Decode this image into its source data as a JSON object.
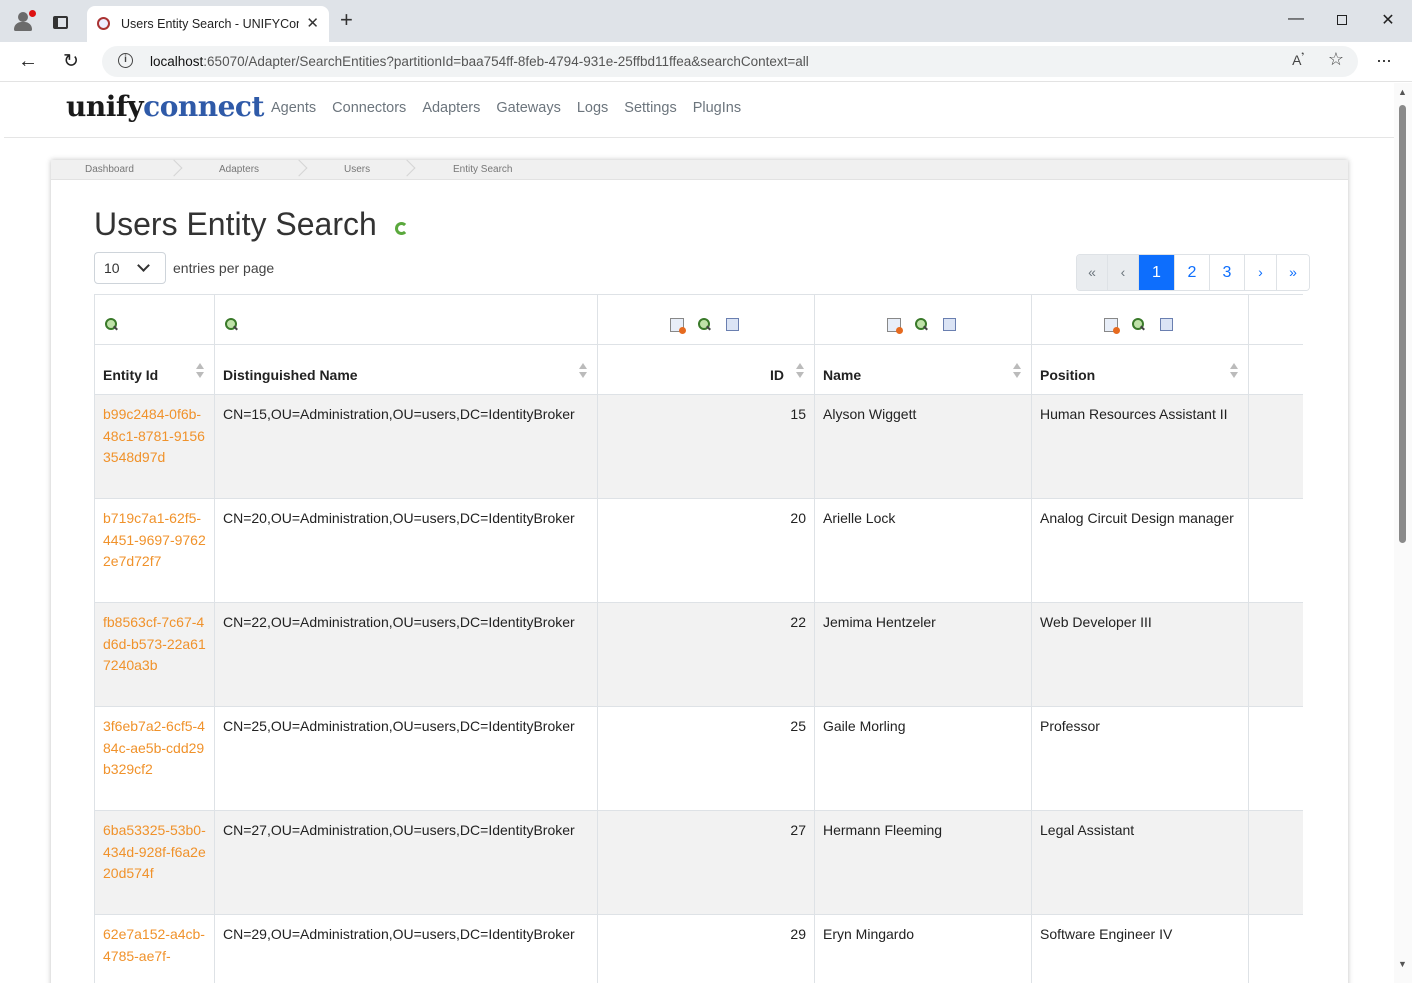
{
  "browser": {
    "tab_title": "Users Entity Search - UNIFYConnect",
    "tab_close": "✕",
    "new_tab": "+",
    "url_host": "localhost",
    "url_rest": ":65070/Adapter/SearchEntities?partitionId=baa754ff-8feb-4794-931e-25ffbd11ffea&searchContext=all",
    "window": {
      "minimize": "—",
      "close": "✕"
    }
  },
  "app": {
    "logo_part1": "unify",
    "logo_part2": "connect",
    "nav": [
      "Agents",
      "Connectors",
      "Adapters",
      "Gateways",
      "Logs",
      "Settings",
      "PlugIns"
    ]
  },
  "breadcrumbs": [
    "Dashboard",
    "Adapters",
    "Users",
    "Entity Search"
  ],
  "page": {
    "title": "Users Entity Search",
    "page_size": "10",
    "page_size_label": "entries per page"
  },
  "pagination": {
    "first": "«",
    "prev": "‹",
    "pages": [
      "1",
      "2",
      "3"
    ],
    "current": "1",
    "next": "›",
    "last": "»"
  },
  "table": {
    "columns": [
      "Entity Id",
      "Distinguished Name",
      "ID",
      "Name",
      "Position"
    ],
    "rows": [
      {
        "entity_id": "b99c2484-0f6b-48c1-8781-91563548d97d",
        "dn": "CN=15,OU=Administration,OU=users,DC=IdentityBroker",
        "id": "15",
        "name": "Alyson Wiggett",
        "position": "Human Resources Assistant II"
      },
      {
        "entity_id": "b719c7a1-62f5-4451-9697-97622e7d72f7",
        "dn": "CN=20,OU=Administration,OU=users,DC=IdentityBroker",
        "id": "20",
        "name": "Arielle Lock",
        "position": "Analog Circuit Design manager"
      },
      {
        "entity_id": "fb8563cf-7c67-4d6d-b573-22a617240a3b",
        "dn": "CN=22,OU=Administration,OU=users,DC=IdentityBroker",
        "id": "22",
        "name": "Jemima Hentzeler",
        "position": "Web Developer III"
      },
      {
        "entity_id": "3f6eb7a2-6cf5-484c-ae5b-cdd29b329cf2",
        "dn": "CN=25,OU=Administration,OU=users,DC=IdentityBroker",
        "id": "25",
        "name": "Gaile Morling",
        "position": "Professor"
      },
      {
        "entity_id": "6ba53325-53b0-434d-928f-f6a2e20d574f",
        "dn": "CN=27,OU=Administration,OU=users,DC=IdentityBroker",
        "id": "27",
        "name": "Hermann Fleeming",
        "position": "Legal Assistant"
      },
      {
        "entity_id": "62e7a152-a4cb-4785-ae7f-",
        "dn": "CN=29,OU=Administration,OU=users,DC=IdentityBroker",
        "id": "29",
        "name": "Eryn Mingardo",
        "position": "Software Engineer IV"
      }
    ]
  }
}
